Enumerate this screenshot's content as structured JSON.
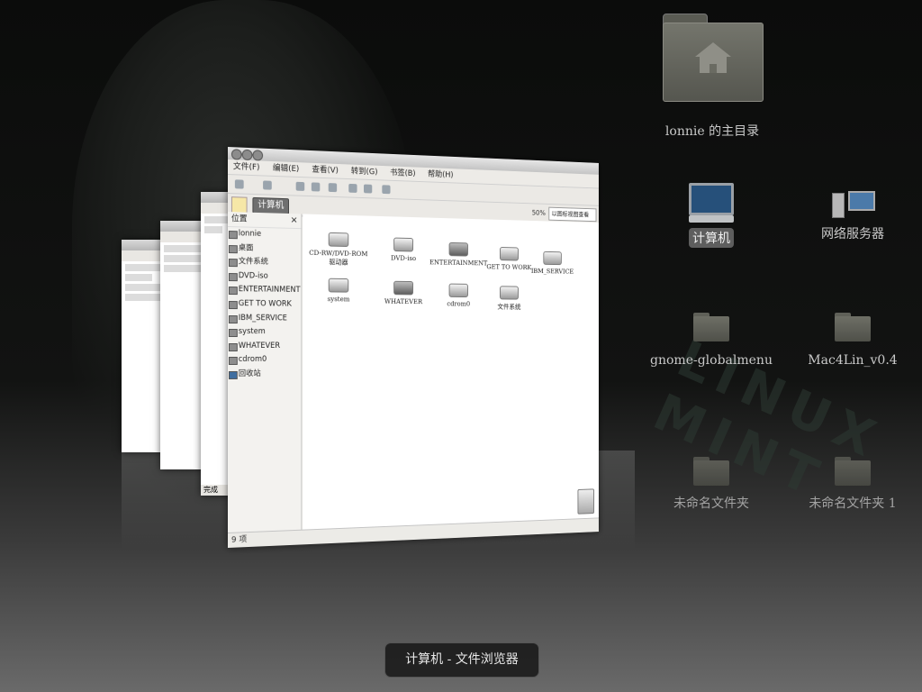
{
  "desktop": {
    "icons": [
      {
        "label": "lonnie 的主目录",
        "icon": "home-folder-icon"
      },
      {
        "label": "计算机",
        "icon": "computer-icon"
      },
      {
        "label": "网络服务器",
        "icon": "network-servers-icon"
      },
      {
        "label": "gnome-globalmenu",
        "icon": "folder-icon"
      },
      {
        "label": "Mac4Lin_v0.4",
        "icon": "folder-icon"
      },
      {
        "label": "未命名文件夹",
        "icon": "folder-icon"
      },
      {
        "label": "未命名文件夹 1",
        "icon": "folder-icon"
      }
    ],
    "watermark": "LINUX MINT"
  },
  "switcher": {
    "caption": "计算机 - 文件浏览器"
  },
  "file_browser": {
    "menu": [
      "文件(F)",
      "编辑(E)",
      "查看(V)",
      "转到(G)",
      "书签(B)",
      "帮助(H)"
    ],
    "location_button": "计算机",
    "zoom": "50%",
    "view_mode": "以图标视图查看",
    "sidebar_title": "位置",
    "sidebar_items": [
      "lonnie",
      "桌面",
      "文件系统",
      "DVD-iso",
      "ENTERTAINMENT",
      "GET TO WORK",
      "IBM_SERVICE",
      "system",
      "WHATEVER",
      "cdrom0",
      "回收站"
    ],
    "files": [
      {
        "label": "CD-RW/DVD-ROM 驱动器"
      },
      {
        "label": "DVD-iso"
      },
      {
        "label": "ENTERTAINMENT"
      },
      {
        "label": "GET TO WORK"
      },
      {
        "label": "IBM_SERVICE"
      },
      {
        "label": "system"
      },
      {
        "label": "WHATEVER"
      },
      {
        "label": "cdrom0"
      },
      {
        "label": "文件系统"
      }
    ],
    "status": "9 项"
  },
  "background_windows": {
    "status_left": "完成"
  }
}
